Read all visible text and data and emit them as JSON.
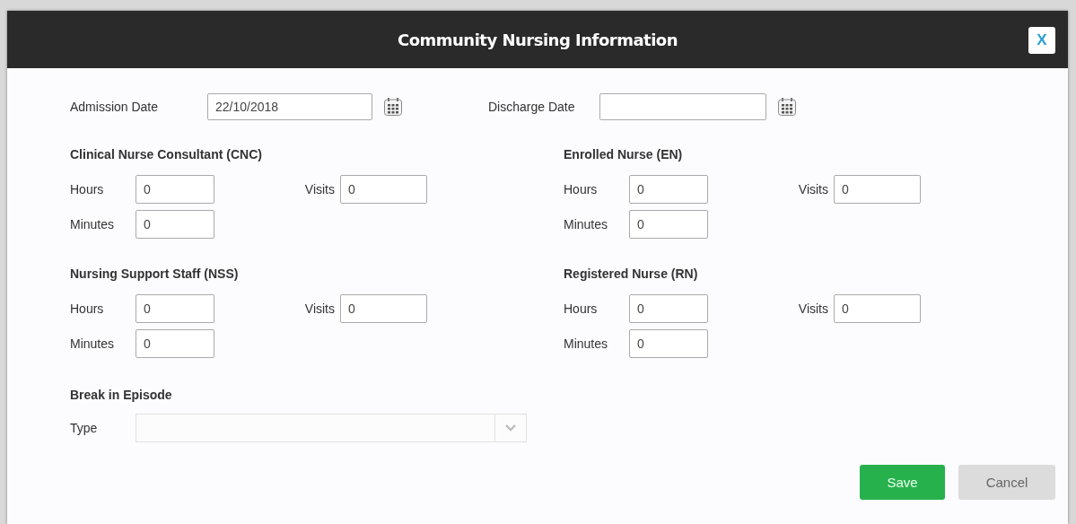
{
  "dialog": {
    "title": "Community Nursing Information",
    "close_label": "X"
  },
  "dates": [
    {
      "label": "Admission Date",
      "value": "22/10/2018"
    },
    {
      "label": "Discharge Date"
    }
  ],
  "sections": [
    {
      "title": "Clinical Nurse Consultant (CNC)",
      "hours": {
        "label": "Hours",
        "value": "0"
      },
      "visits": {
        "label": "Visits",
        "value": "0"
      },
      "minutes": {
        "label": "Minutes",
        "value": "0"
      }
    },
    {
      "title": "Enrolled Nurse (EN)",
      "hours": {
        "label": "Hours",
        "value": "0"
      },
      "visits": {
        "label": "Visits",
        "value": "0"
      },
      "minutes": {
        "label": "Minutes",
        "value": "0"
      }
    },
    {
      "title": "Nursing Support Staff (NSS)",
      "hours": {
        "label": "Hours",
        "value": "0"
      },
      "visits": {
        "label": "Visits",
        "value": "0"
      },
      "minutes": {
        "label": "Minutes",
        "value": "0"
      }
    },
    {
      "title": "Registered Nurse (RN)",
      "hours": {
        "label": "Hours",
        "value": "0"
      },
      "visits": {
        "label": "Visits",
        "value": "0"
      },
      "minutes": {
        "label": "Minutes",
        "value": "0"
      }
    }
  ],
  "break_in_episode": {
    "title": "Break in Episode",
    "type": {
      "label": "Type",
      "disabled": true
    }
  },
  "buttons": [
    {
      "label": "Save",
      "kind": "primary"
    },
    {
      "label": "Cancel",
      "kind": "secondary"
    }
  ]
}
